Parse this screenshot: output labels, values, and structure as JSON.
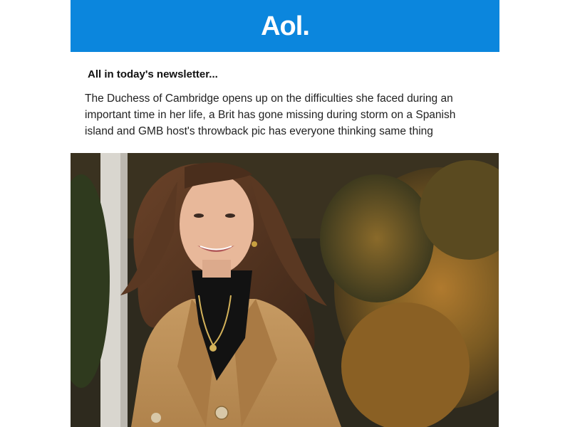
{
  "header": {
    "logo_text": "Aol.",
    "brand_color": "#0b86dd"
  },
  "newsletter": {
    "heading": "All in today's newsletter...",
    "summary": "The Duchess of Cambridge opens up on the difficulties she faced during an important time in her life, a Brit has gone missing during storm on a Spanish island and GMB host's throwback pic has everyone thinking same thing"
  },
  "hero_image": {
    "subject": "woman-in-camel-coat-photo"
  }
}
